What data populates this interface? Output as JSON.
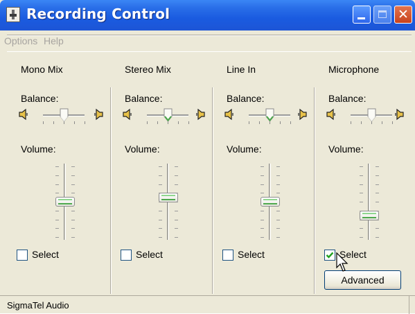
{
  "window": {
    "title": "Recording Control"
  },
  "menu": {
    "items": [
      "Options",
      "Help"
    ]
  },
  "channels": [
    {
      "name": "Mono Mix",
      "balance_label": "Balance:",
      "volume_label": "Volume:",
      "select_label": "Select",
      "selected": false,
      "balance": 0.5,
      "volume": 0.5
    },
    {
      "name": "Stereo Mix",
      "balance_label": "Balance:",
      "volume_label": "Volume:",
      "select_label": "Select",
      "selected": false,
      "balance": 0.5,
      "volume": 0.56
    },
    {
      "name": "Line In",
      "balance_label": "Balance:",
      "volume_label": "Volume:",
      "select_label": "Select",
      "selected": false,
      "balance": 0.5,
      "volume": 0.5
    },
    {
      "name": "Microphone",
      "balance_label": "Balance:",
      "volume_label": "Volume:",
      "select_label": "Select",
      "selected": true,
      "balance": 0.5,
      "volume": 0.3
    }
  ],
  "advanced_button": "Advanced",
  "status": {
    "text": "SigmaTel Audio"
  },
  "colors": {
    "title_blue": "#1d55d6",
    "face": "#ece9d8",
    "slider_green": "#4ca84c",
    "check_green": "#21a121"
  },
  "icons": [
    "app-mixer-icon",
    "minimize-icon",
    "maximize-icon",
    "close-icon",
    "speaker-left-icon",
    "speaker-right-icon",
    "mouse-pointer-icon"
  ]
}
